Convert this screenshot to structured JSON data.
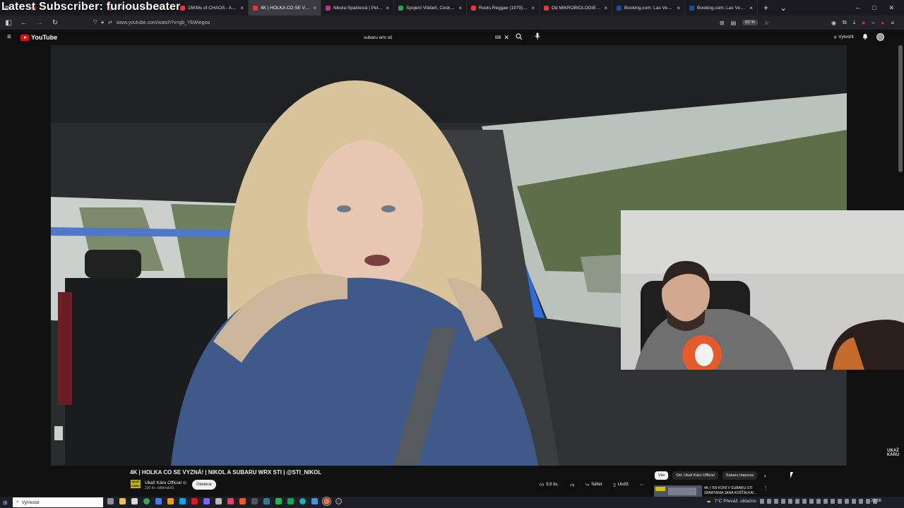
{
  "overlay": {
    "latest_subscriber": "Latest Subscriber: furiousbeater"
  },
  "browser": {
    "tabs": [
      {
        "title": "",
        "color": "#888888",
        "active": false
      },
      {
        "title": "",
        "color": "#e33",
        "active": false
      },
      {
        "title": "SAUŘI BYLI JEŠTĚ HO",
        "color": "#e33",
        "active": false
      },
      {
        "title": "15KMs of CHAOS - Abando",
        "color": "#e33",
        "active": false
      },
      {
        "title": "4K | HOLKA CO SE VYZ",
        "color": "#e33",
        "active": true
      },
      {
        "title": "Nikola Špačková | Petrolhe",
        "color": "#c13584",
        "active": false
      },
      {
        "title": "Spojení Vlášeň, Česko, P...",
        "color": "#2ea44f",
        "active": false
      },
      {
        "title": "Roots Reggae (1979) [Lost ",
        "color": "#e33",
        "active": false
      },
      {
        "title": "Od MIKROBIOLOGIE ke STi",
        "color": "#e33",
        "active": false
      },
      {
        "title": "Booking.com: Las Vegas - h",
        "color": "#1a4fa3",
        "active": false
      },
      {
        "title": "Booking.com: Las Vegas - h",
        "color": "#1a4fa3",
        "active": false
      }
    ],
    "new_tab": "+",
    "tab_list": "⌄",
    "win_min": "–",
    "win_max": "□",
    "win_close": "✕",
    "url": "www.youtube.com/watch?v=gb_YbWiegoo",
    "zoom": "80 %"
  },
  "youtube": {
    "logo_text": "YouTube",
    "search_value": "subaru wrx sti",
    "keyboard": "⌨",
    "clear": "✕",
    "create_label": "Vytvořit",
    "video_title": "4K | HOLKA CO SE VYZNÁ! | NIKOL A SUBARU WRX STI | @STI_NIKOL",
    "channel_avatar": "UKAŽ KÁRU",
    "channel_name": "Ukaž Káru Official ⊙",
    "channel_subs": "230 tis. odběratelů",
    "subscribe_label": "Odebírat",
    "watermark": "UKAŽ KÁRU",
    "actions": {
      "like_count": "3,6 tis.",
      "share_label": "Sdílet",
      "save_label": "Uložit",
      "more": "⋯"
    },
    "chips": [
      {
        "label": "Vše",
        "selected": true
      },
      {
        "label": "Od: Ukaž Káru Official",
        "selected": false
      },
      {
        "label": "Subaru Impreza",
        "selected": false
      }
    ],
    "chips_next": "›",
    "recommendation_title": "4K | 700 KONÍ V SUBARU STI SPARTANIA JANA KOŠŤÁLKA!..."
  },
  "taskbar": {
    "search_placeholder": "Vyhledat",
    "weather": "7°C  Převáž. oblačno",
    "time": "23:56"
  }
}
